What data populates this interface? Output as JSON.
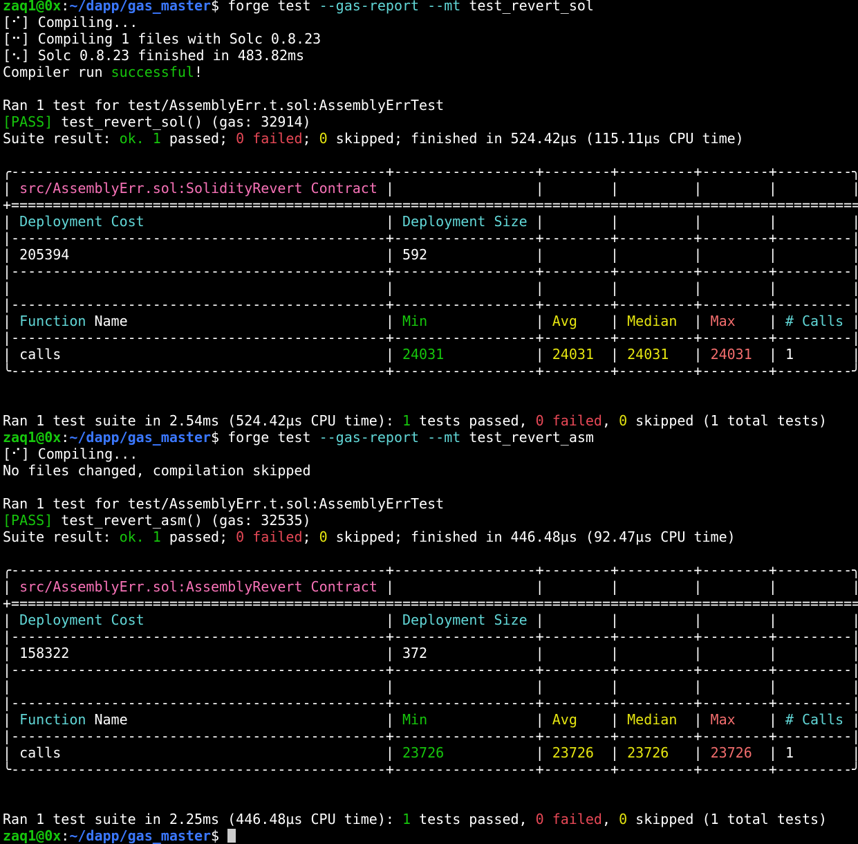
{
  "colors": {
    "background": "#000000",
    "foreground": "#ffffff",
    "prompt_user": "#16c60c",
    "prompt_path": "#3b78ff",
    "success": "#16c60c",
    "fail": "#e74856",
    "contract": "#f772b7",
    "header_cyan": "#61d6d6",
    "min_green": "#16c60c",
    "avg_yellow": "#e5e510",
    "max_red": "#f26d6d"
  },
  "lines": [
    [
      {
        "c": "prompt-user",
        "t": "zaq1@0x"
      },
      {
        "t": ":"
      },
      {
        "c": "prompt-path",
        "t": "~/dapp/gas_master"
      },
      {
        "t": "$ forge test "
      },
      {
        "c": "c",
        "t": "--gas-report --mt"
      },
      {
        "t": " test_revert_sol"
      }
    ],
    [
      {
        "t": "[⠊] Compiling..."
      }
    ],
    [
      {
        "t": "[⠒] Compiling 1 files with Solc 0.8.23"
      }
    ],
    [
      {
        "t": "[⠢] Solc 0.8.23 finished in 483.82ms"
      }
    ],
    [
      {
        "t": "Compiler run "
      },
      {
        "c": "g",
        "t": "successful"
      },
      {
        "t": "!"
      }
    ],
    [
      {
        "t": ""
      }
    ],
    [
      {
        "t": "Ran 1 test for test/AssemblyErr.t.sol:AssemblyErrTest"
      }
    ],
    [
      {
        "c": "g",
        "t": "[PASS]"
      },
      {
        "t": " test_revert_sol() (gas: 32914)"
      }
    ],
    [
      {
        "t": "Suite result: "
      },
      {
        "c": "g",
        "t": "ok."
      },
      {
        "t": " "
      },
      {
        "c": "g",
        "t": "1"
      },
      {
        "t": " passed; "
      },
      {
        "c": "r",
        "t": "0 failed"
      },
      {
        "t": "; "
      },
      {
        "c": "yy",
        "t": "0"
      },
      {
        "t": " skipped; finished in 524.42µs (115.11µs CPU time)"
      }
    ],
    [
      {
        "t": ""
      }
    ],
    [
      {
        "t": "╭---------------------------------------------+-----------------+--------+---------+--------+---------╮"
      }
    ],
    [
      {
        "t": "| "
      },
      {
        "c": "m",
        "t": "src/AssemblyErr.sol:SolidityRevert Contract"
      },
      {
        "t": " |                 |        |         |        |         |"
      }
    ],
    [
      {
        "t": "+========================================================================================================+"
      }
    ],
    [
      {
        "t": "| "
      },
      {
        "c": "c",
        "t": "Deployment Cost"
      },
      {
        "t": "                             | "
      },
      {
        "c": "c",
        "t": "Deployment Size"
      },
      {
        "t": " |        |         |        |         |"
      }
    ],
    [
      {
        "t": "|---------------------------------------------+-----------------+--------+---------+--------+---------|"
      }
    ],
    [
      {
        "t": "| 205394                                      | 592             |        |         |        |         |"
      }
    ],
    [
      {
        "t": "|---------------------------------------------+-----------------+--------+---------+--------+---------|"
      }
    ],
    [
      {
        "t": "|                                             |                 |        |         |        |         |"
      }
    ],
    [
      {
        "t": "|---------------------------------------------+-----------------+--------+---------+--------+---------|"
      }
    ],
    [
      {
        "t": "| "
      },
      {
        "c": "c",
        "t": "Function"
      },
      {
        "t": " Name                               | "
      },
      {
        "c": "g",
        "t": "Min"
      },
      {
        "t": "             | "
      },
      {
        "c": "yy",
        "t": "Avg"
      },
      {
        "t": "    | "
      },
      {
        "c": "yy",
        "t": "Median"
      },
      {
        "t": "  | "
      },
      {
        "c": "rr",
        "t": "Max"
      },
      {
        "t": "    | "
      },
      {
        "c": "c",
        "t": "# Calls"
      },
      {
        "t": " |"
      }
    ],
    [
      {
        "t": "|---------------------------------------------+-----------------+--------+---------+--------+---------|"
      }
    ],
    [
      {
        "t": "| calls                                       | "
      },
      {
        "c": "g",
        "t": "24031"
      },
      {
        "t": "           | "
      },
      {
        "c": "yy",
        "t": "24031"
      },
      {
        "t": "  | "
      },
      {
        "c": "yy",
        "t": "24031"
      },
      {
        "t": "   | "
      },
      {
        "c": "rr",
        "t": "24031"
      },
      {
        "t": "  | 1       |"
      }
    ],
    [
      {
        "t": "╰---------------------------------------------+-----------------+--------+---------+--------+---------╯"
      }
    ],
    [
      {
        "t": ""
      }
    ],
    [
      {
        "t": ""
      }
    ],
    [
      {
        "t": "Ran 1 test suite in 2.54ms (524.42µs CPU time): "
      },
      {
        "c": "g",
        "t": "1"
      },
      {
        "t": " tests passed, "
      },
      {
        "c": "r",
        "t": "0 failed"
      },
      {
        "t": ", "
      },
      {
        "c": "yy",
        "t": "0"
      },
      {
        "t": " skipped (1 total tests)"
      }
    ],
    [
      {
        "c": "prompt-user",
        "t": "zaq1@0x"
      },
      {
        "t": ":"
      },
      {
        "c": "prompt-path",
        "t": "~/dapp/gas_master"
      },
      {
        "t": "$ forge test "
      },
      {
        "c": "c",
        "t": "--gas-report --mt"
      },
      {
        "t": " test_revert_asm"
      }
    ],
    [
      {
        "t": "[⠊] Compiling..."
      }
    ],
    [
      {
        "t": "No files changed, compilation skipped"
      }
    ],
    [
      {
        "t": ""
      }
    ],
    [
      {
        "t": "Ran 1 test for test/AssemblyErr.t.sol:AssemblyErrTest"
      }
    ],
    [
      {
        "c": "g",
        "t": "[PASS]"
      },
      {
        "t": " test_revert_asm() (gas: 32535)"
      }
    ],
    [
      {
        "t": "Suite result: "
      },
      {
        "c": "g",
        "t": "ok."
      },
      {
        "t": " "
      },
      {
        "c": "g",
        "t": "1"
      },
      {
        "t": " passed; "
      },
      {
        "c": "r",
        "t": "0 failed"
      },
      {
        "t": "; "
      },
      {
        "c": "yy",
        "t": "0"
      },
      {
        "t": " skipped; finished in 446.48µs (92.47µs CPU time)"
      }
    ],
    [
      {
        "t": ""
      }
    ],
    [
      {
        "t": "╭---------------------------------------------+-----------------+--------+---------+--------+---------╮"
      }
    ],
    [
      {
        "t": "| "
      },
      {
        "c": "m",
        "t": "src/AssemblyErr.sol:AssemblyRevert Contract"
      },
      {
        "t": " |                 |        |         |        |         |"
      }
    ],
    [
      {
        "t": "+========================================================================================================+"
      }
    ],
    [
      {
        "t": "| "
      },
      {
        "c": "c",
        "t": "Deployment Cost"
      },
      {
        "t": "                             | "
      },
      {
        "c": "c",
        "t": "Deployment Size"
      },
      {
        "t": " |        |         |        |         |"
      }
    ],
    [
      {
        "t": "|---------------------------------------------+-----------------+--------+---------+--------+---------|"
      }
    ],
    [
      {
        "t": "| 158322                                      | 372             |        |         |        |         |"
      }
    ],
    [
      {
        "t": "|---------------------------------------------+-----------------+--------+---------+--------+---------|"
      }
    ],
    [
      {
        "t": "|                                             |                 |        |         |        |         |"
      }
    ],
    [
      {
        "t": "|---------------------------------------------+-----------------+--------+---------+--------+---------|"
      }
    ],
    [
      {
        "t": "| "
      },
      {
        "c": "c",
        "t": "Function"
      },
      {
        "t": " Name                               | "
      },
      {
        "c": "g",
        "t": "Min"
      },
      {
        "t": "             | "
      },
      {
        "c": "yy",
        "t": "Avg"
      },
      {
        "t": "    | "
      },
      {
        "c": "yy",
        "t": "Median"
      },
      {
        "t": "  | "
      },
      {
        "c": "rr",
        "t": "Max"
      },
      {
        "t": "    | "
      },
      {
        "c": "c",
        "t": "# Calls"
      },
      {
        "t": " |"
      }
    ],
    [
      {
        "t": "|---------------------------------------------+-----------------+--------+---------+--------+---------|"
      }
    ],
    [
      {
        "t": "| calls                                       | "
      },
      {
        "c": "g",
        "t": "23726"
      },
      {
        "t": "           | "
      },
      {
        "c": "yy",
        "t": "23726"
      },
      {
        "t": "  | "
      },
      {
        "c": "yy",
        "t": "23726"
      },
      {
        "t": "   | "
      },
      {
        "c": "rr",
        "t": "23726"
      },
      {
        "t": "  | 1       |"
      }
    ],
    [
      {
        "t": "╰---------------------------------------------+-----------------+--------+---------+--------+---------╯"
      }
    ],
    [
      {
        "t": ""
      }
    ],
    [
      {
        "t": ""
      }
    ],
    [
      {
        "t": "Ran 1 test suite in 2.25ms (446.48µs CPU time): "
      },
      {
        "c": "g",
        "t": "1"
      },
      {
        "t": " tests passed, "
      },
      {
        "c": "r",
        "t": "0 failed"
      },
      {
        "t": ", "
      },
      {
        "c": "yy",
        "t": "0"
      },
      {
        "t": " skipped (1 total tests)"
      }
    ],
    [
      {
        "c": "prompt-user",
        "t": "zaq1@0x"
      },
      {
        "t": ":"
      },
      {
        "c": "prompt-path",
        "t": "~/dapp/gas_master"
      },
      {
        "t": "$ "
      },
      {
        "cursor": true
      }
    ]
  ]
}
